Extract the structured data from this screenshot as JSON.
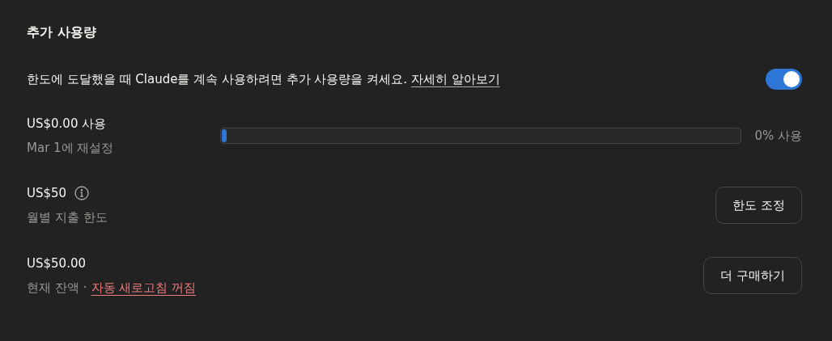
{
  "title": "추가 사용량",
  "description": {
    "text": "한도에 도달했을 때 Claude를 계속 사용하려면 추가 사용량을 켜세요.",
    "link": "자세히 알아보기"
  },
  "toggle": {
    "on": true
  },
  "usage": {
    "amount": "US$0.00 사용",
    "reset": "Mar 1에 재설정",
    "level": 0.01,
    "reading": "0% 사용"
  },
  "limit": {
    "amount": "US$50",
    "label": "월별 지출 한도",
    "button": "한도 조정"
  },
  "balance": {
    "amount": "US$50.00",
    "label": "현재 잔액",
    "separator": "·",
    "link": "자동 새로고침 꺼짐",
    "button": "더 구매하기"
  }
}
